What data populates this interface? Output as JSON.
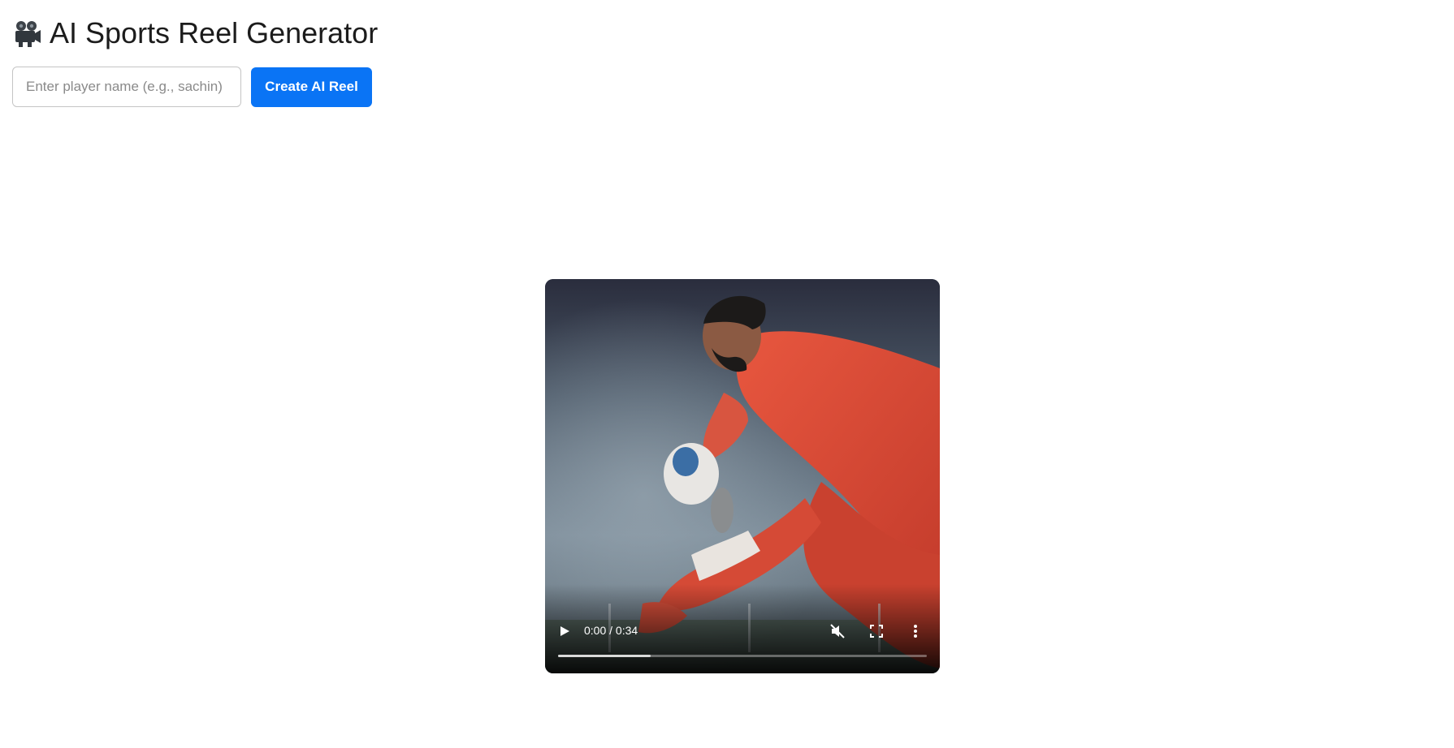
{
  "header": {
    "emoji_icon": "movie-camera-icon",
    "title": "AI Sports Reel Generator"
  },
  "form": {
    "player_input_value": "",
    "player_input_placeholder": "Enter player name (e.g., sachin)",
    "create_button_label": "Create AI Reel",
    "accent_color": "#0a74f5"
  },
  "video": {
    "time_display": "0:00 / 0:34",
    "buffered_fraction": 0.25,
    "muted": true,
    "icons": {
      "play": "play-icon",
      "mute": "volume-muted-icon",
      "fullscreen": "fullscreen-icon",
      "more": "more-vertical-icon"
    }
  }
}
